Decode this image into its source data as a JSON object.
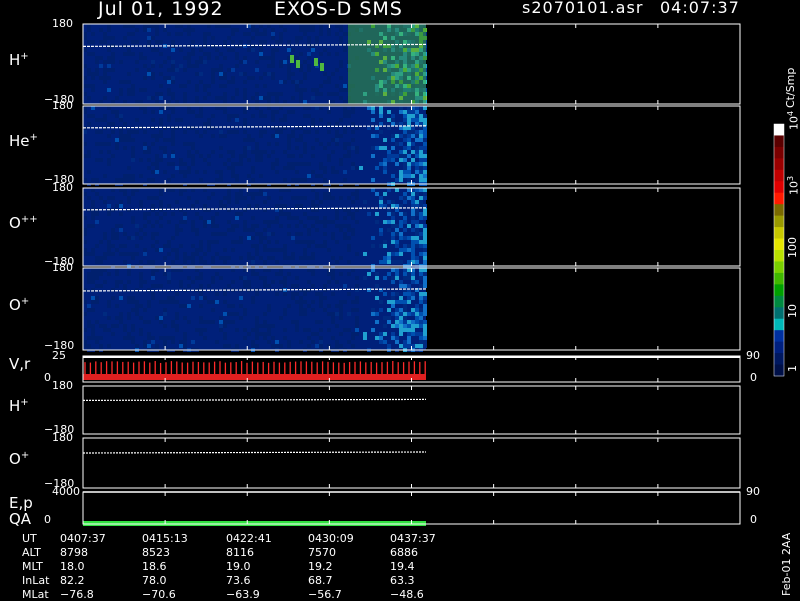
{
  "header": {
    "date": "Jul 01, 1992",
    "instrument": "EXOS-D SMS",
    "filename": "s2070101.asr",
    "start_time": "04:07:37"
  },
  "panels": [
    {
      "id": "h_plus",
      "label_base": "H",
      "label_sup": "+",
      "ytop": "180",
      "ybot": "−180",
      "type": "spectrogram",
      "data_end_frac": 0.69
    },
    {
      "id": "he_plus",
      "label_base": "He",
      "label_sup": "+",
      "ytop": "180",
      "ybot": "−180",
      "type": "spectrogram",
      "data_end_frac": 0.69
    },
    {
      "id": "o_pp",
      "label_base": "O",
      "label_sup": "++",
      "ytop": "180",
      "ybot": "−180",
      "type": "spectrogram",
      "data_end_frac": 0.69
    },
    {
      "id": "o_plus",
      "label_base": "O",
      "label_sup": "+",
      "ytop": "180",
      "ybot": "−180",
      "type": "spectrogram",
      "data_end_frac": 0.69
    },
    {
      "id": "vr",
      "label_base": "V,r",
      "label_sup": "",
      "ytop": "25",
      "ybot": "0",
      "rtop": "90",
      "rbot": "0",
      "type": "potential"
    },
    {
      "id": "h_plus_2",
      "label_base": "H",
      "label_sup": "+",
      "ytop": "180",
      "ybot": "−180",
      "type": "line"
    },
    {
      "id": "o_plus_2",
      "label_base": "O",
      "label_sup": "+",
      "ytop": "180",
      "ybot": "−180",
      "type": "line"
    },
    {
      "id": "ep_qa",
      "label_base": "E,p",
      "label2": "QA",
      "ytop": "4000",
      "ybot": "0",
      "rtop": "90",
      "rbot": "0",
      "type": "qa"
    }
  ],
  "colorbar": {
    "unit": "Ct/Smp",
    "labels": [
      {
        "base": "10",
        "sup": "4"
      },
      {
        "base": "10",
        "sup": "3"
      },
      {
        "base": "100",
        "sup": ""
      },
      {
        "base": "10",
        "sup": ""
      },
      {
        "base": "1",
        "sup": ""
      }
    ],
    "colors": [
      "#ffffff",
      "#5a0000",
      "#7a0000",
      "#9a0000",
      "#c00000",
      "#e00000",
      "#ff1a00",
      "#7a6a00",
      "#9a9a00",
      "#c8c800",
      "#e6e600",
      "#b8e000",
      "#7ad000",
      "#40b800",
      "#00a000",
      "#008a40",
      "#007070",
      "#00b8b8",
      "#0030a0",
      "#002080",
      "#001860",
      "#001048"
    ]
  },
  "footer": {
    "row_labels": [
      "UT",
      "ALT",
      "MLT",
      "InLat",
      "MLat"
    ],
    "columns": [
      [
        "0407:37",
        "8798",
        "18.0",
        "82.2",
        "−76.8"
      ],
      [
        "0415:13",
        "8523",
        "18.6",
        "78.0",
        "−70.6"
      ],
      [
        "0422:41",
        "8116",
        "19.0",
        "73.6",
        "−63.9"
      ],
      [
        "0430:09",
        "7570",
        "19.2",
        "68.7",
        "−56.7"
      ],
      [
        "0437:37",
        "6886",
        "19.4",
        "63.3",
        "−48.6"
      ]
    ]
  },
  "side_note": "Feb-01 2AA",
  "chart_data": {
    "type": "heatmap",
    "title": "Jul 01, 1992   EXOS-D SMS",
    "x": [
      "0407:37",
      "0415:13",
      "0422:41",
      "0430:09",
      "0437:37"
    ],
    "series": [
      {
        "name": "H+",
        "ylim": [
          -180,
          180
        ]
      },
      {
        "name": "He+",
        "ylim": [
          -180,
          180
        ]
      },
      {
        "name": "O++",
        "ylim": [
          -180,
          180
        ]
      },
      {
        "name": "O+",
        "ylim": [
          -180,
          180
        ]
      },
      {
        "name": "V,r",
        "ylim": [
          0,
          25
        ],
        "right_ylim": [
          0,
          90
        ]
      },
      {
        "name": "H+",
        "ylim": [
          -180,
          180
        ]
      },
      {
        "name": "O+",
        "ylim": [
          -180,
          180
        ]
      },
      {
        "name": "E,p / QA",
        "ylim": [
          0,
          4000
        ],
        "right_ylim": [
          0,
          90
        ]
      }
    ],
    "colorscale": {
      "unit": "Ct/Smp",
      "ticks": [
        "1",
        "10",
        "100",
        "10^3",
        "10^4"
      ]
    }
  }
}
